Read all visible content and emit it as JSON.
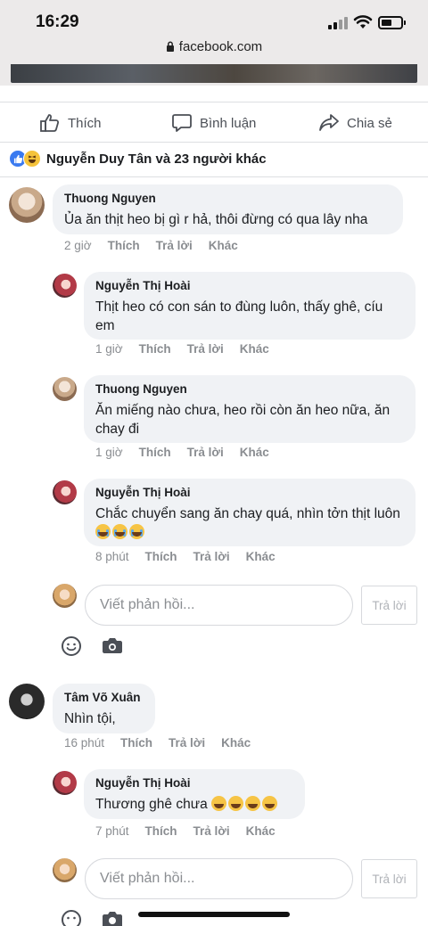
{
  "status_bar": {
    "time": "16:29",
    "url": "facebook.com"
  },
  "actions": {
    "like": "Thích",
    "comment": "Bình luận",
    "share": "Chia sẻ"
  },
  "reactions": {
    "text": "Nguyễn Duy Tân và 23 người khác",
    "icons": [
      "like-icon",
      "haha-icon"
    ]
  },
  "comments": [
    {
      "author": "Thuong Nguyen",
      "text": "Ủa ăn thịt heo bị gì r hả, thôi đừng có qua lây nha",
      "time": "2 giờ",
      "like": "Thích",
      "reply": "Trả lời",
      "more": "Khác",
      "replies": [
        {
          "author": "Nguyễn Thị Hoài",
          "text": "Thịt heo có con sán to đùng luôn, thấy ghê, cíu em",
          "time": "1 giờ",
          "like": "Thích",
          "reply": "Trả lời",
          "more": "Khác"
        },
        {
          "author": "Thuong Nguyen",
          "text": "Ăn miếng nào chưa, heo rồi còn ăn heo nữa, ăn chay đi",
          "time": "1 giờ",
          "like": "Thích",
          "reply": "Trả lời",
          "more": "Khác"
        },
        {
          "author": "Nguyễn Thị Hoài",
          "text": "Chắc chuyển sang ăn chay quá, nhìn tởn thịt luôn",
          "time": "8 phút",
          "like": "Thích",
          "reply": "Trả lời",
          "more": "Khác",
          "emojis": [
            "crying-face",
            "crying-face",
            "crying-face"
          ]
        }
      ]
    },
    {
      "author": "Tâm Võ Xuân",
      "text": "Nhìn tội,",
      "time": "16 phút",
      "like": "Thích",
      "reply": "Trả lời",
      "more": "Khác",
      "replies": [
        {
          "author": "Nguyễn Thị Hoài",
          "text": "Thương ghê chưa",
          "time": "7 phút",
          "like": "Thích",
          "reply": "Trả lời",
          "more": "Khác",
          "emojis": [
            "grinning-face",
            "grinning-face",
            "grinning-face",
            "grinning-face"
          ]
        }
      ]
    }
  ],
  "reply_box": {
    "placeholder": "Viết phản hồi...",
    "button": "Trả lời"
  },
  "colors": {
    "like_blue": "#3a7af0",
    "bubble_bg": "#f0f2f5",
    "meta_gray": "#8a8d91"
  }
}
